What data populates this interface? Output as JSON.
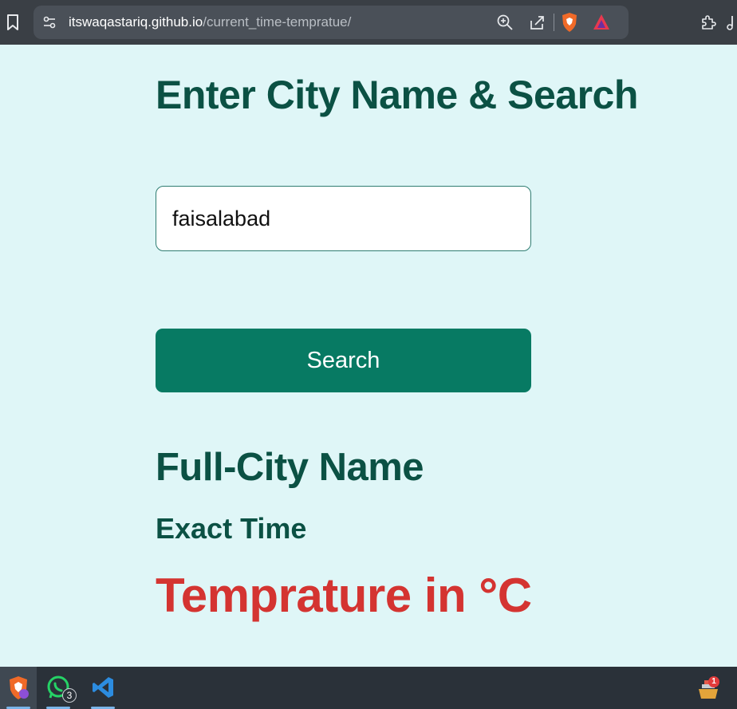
{
  "browser": {
    "url_domain": "itswaqastariq.github.io",
    "url_path": "/current_time-tempratue/"
  },
  "page": {
    "heading": "Enter City Name & Search",
    "city_input_value": "faisalabad",
    "search_button_label": "Search",
    "city_name_text": "Full-City Name",
    "exact_time_text": "Exact Time",
    "temperature_text": "Temprature in °C"
  },
  "taskbar": {
    "whatsapp_badge": "3",
    "tray_badge": "1"
  },
  "colors": {
    "background": "#dff6f7",
    "heading": "#0b5144",
    "button": "#077a63",
    "temperature": "#d43431"
  },
  "icons": [
    "bookmark-icon",
    "site-info-icon",
    "zoom-icon",
    "share-icon",
    "brave-shield-icon",
    "brave-rewards-icon",
    "extensions-icon",
    "media-icon",
    "brave-app-icon",
    "whatsapp-icon",
    "vscode-icon",
    "tray-app-icon"
  ]
}
